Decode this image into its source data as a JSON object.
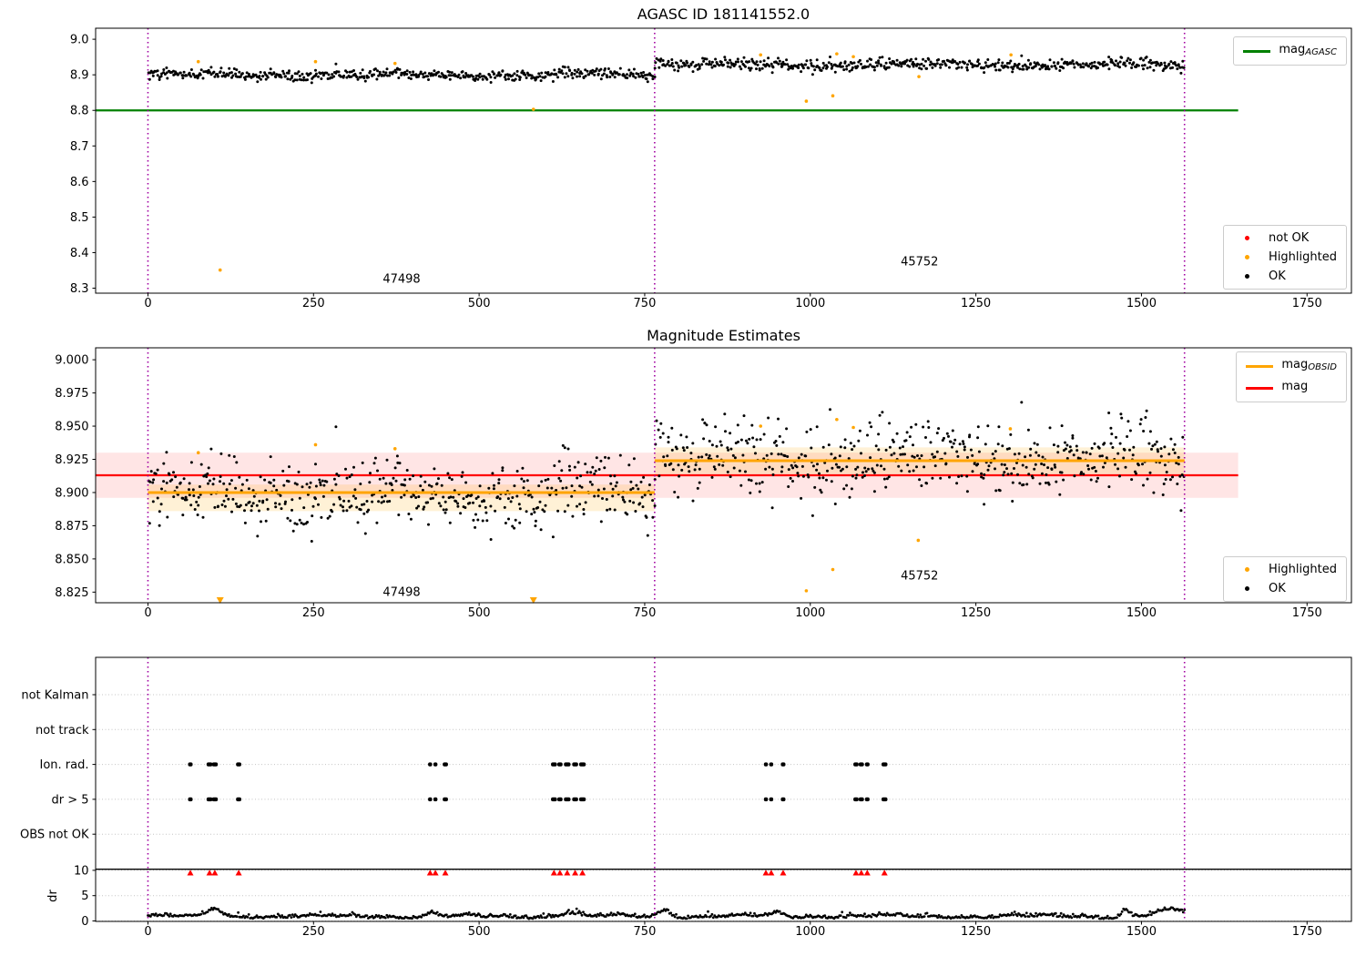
{
  "colors": {
    "green": "#008000",
    "red": "#ff0000",
    "orange": "#ffa500",
    "black": "#000000",
    "boundary": "#a000a0",
    "band_red": "rgba(255,0,0,0.10)",
    "band_orange": "rgba(255,165,0,0.16)",
    "grid": "#c4c4c4"
  },
  "chart_data": [
    {
      "type": "scatter",
      "title": "AGASC ID 181141552.0",
      "xlim": [
        -79,
        1817
      ],
      "ylim": [
        8.286,
        9.031
      ],
      "xticks": [
        0,
        250,
        500,
        750,
        1000,
        1250,
        1500,
        1750
      ],
      "yticks": [
        8.3,
        8.4,
        8.5,
        8.6,
        8.7,
        8.8,
        8.9,
        9.0
      ],
      "mag_agasc": 8.8,
      "hline_span": [
        -79,
        1646
      ],
      "obsid_boundaries": [
        0,
        765,
        1565
      ],
      "segments": [
        {
          "obsid": "47498",
          "x0": 0,
          "x1": 765,
          "mean": 8.9,
          "sd": 0.0075,
          "n": 520
        },
        {
          "obsid": "45752",
          "x0": 765,
          "x1": 1565,
          "mean": 8.928,
          "sd": 0.0085,
          "n": 540
        }
      ],
      "highlighted": [
        [
          76,
          8.937
        ],
        [
          109,
          8.351
        ],
        [
          253,
          8.937
        ],
        [
          373,
          8.932
        ],
        [
          582,
          8.803
        ],
        [
          925,
          8.956
        ],
        [
          994,
          8.826
        ],
        [
          1034,
          8.841
        ],
        [
          1040,
          8.959
        ],
        [
          1065,
          8.951
        ],
        [
          1164,
          8.895
        ],
        [
          1303,
          8.956
        ]
      ],
      "annotations": [
        {
          "text": "47498",
          "x": 383,
          "y": 8.3245
        },
        {
          "text": "45752",
          "x": 1165,
          "y": 8.373
        }
      ],
      "legend_line": {
        "label": "mag",
        "sub": "AGASC"
      },
      "legend_markers": [
        {
          "label": "not OK"
        },
        {
          "label": "Highlighted"
        },
        {
          "label": "OK"
        }
      ]
    },
    {
      "type": "scatter",
      "title": "Magnitude Estimates",
      "xlim": [
        -79,
        1817
      ],
      "ylim": [
        8.817,
        9.009
      ],
      "xticks": [
        0,
        250,
        500,
        750,
        1000,
        1250,
        1500,
        1750
      ],
      "yticks": [
        8.825,
        8.85,
        8.875,
        8.9,
        8.925,
        8.95,
        8.975,
        9.0
      ],
      "mag": 8.913,
      "mag_band": [
        8.896,
        8.93
      ],
      "line_span": [
        -79,
        1646
      ],
      "obsid_boundaries": [
        0,
        765,
        1565
      ],
      "segments": [
        {
          "obsid": "47498",
          "x0": 0,
          "x1": 765,
          "mag_obsid": 8.9,
          "band": [
            8.886,
            8.906
          ],
          "mean": 8.899,
          "sd": 0.0125,
          "n": 520
        },
        {
          "obsid": "45752",
          "x0": 765,
          "x1": 1565,
          "mag_obsid": 8.924,
          "band": [
            8.914,
            8.934
          ],
          "mean": 8.925,
          "sd": 0.014,
          "n": 540
        }
      ],
      "highlighted": [
        [
          76,
          8.93
        ],
        [
          253,
          8.936
        ],
        [
          373,
          8.933
        ],
        [
          925,
          8.95
        ],
        [
          994,
          8.826
        ],
        [
          1034,
          8.842
        ],
        [
          1040,
          8.955
        ],
        [
          1065,
          8.949
        ],
        [
          1163,
          8.864
        ],
        [
          1302,
          8.948
        ]
      ],
      "clipped_low_x": [
        109,
        582
      ],
      "annotations": [
        {
          "text": "47498",
          "x": 383,
          "y": 8.8243
        },
        {
          "text": "45752",
          "x": 1165,
          "y": 8.8372
        }
      ],
      "legend_lines": [
        {
          "label": "mag",
          "sub": "OBSID",
          "color": "orange"
        },
        {
          "label": "mag",
          "sub": "",
          "color": "red"
        }
      ],
      "legend_markers": [
        {
          "label": "Highlighted"
        },
        {
          "label": "OK"
        }
      ]
    },
    {
      "type": "flags-timeline",
      "rows": [
        "not Kalman",
        "not track",
        "Ion. rad.",
        "dr > 5",
        "OBS not OK"
      ],
      "rows_with_events": [
        "Ion. rad.",
        "dr > 5"
      ],
      "xlim": [
        -79,
        1817
      ],
      "xticks": [
        0,
        250,
        500,
        750,
        1000,
        1250,
        1500,
        1750
      ],
      "obsid_boundaries": [
        0,
        765,
        1565
      ],
      "events": [
        {
          "x": 64,
          "w": 7
        },
        {
          "x": 93,
          "w": 9
        },
        {
          "x": 101,
          "w": 9
        },
        {
          "x": 137,
          "w": 8
        },
        {
          "x": 426,
          "w": 6
        },
        {
          "x": 434,
          "w": 6
        },
        {
          "x": 449,
          "w": 8
        },
        {
          "x": 613,
          "w": 9
        },
        {
          "x": 622,
          "w": 8
        },
        {
          "x": 633,
          "w": 10
        },
        {
          "x": 645,
          "w": 9
        },
        {
          "x": 656,
          "w": 10
        },
        {
          "x": 933,
          "w": 6
        },
        {
          "x": 941,
          "w": 5
        },
        {
          "x": 959,
          "w": 7
        },
        {
          "x": 1069,
          "w": 8
        },
        {
          "x": 1077,
          "w": 8
        },
        {
          "x": 1086,
          "w": 7
        },
        {
          "x": 1112,
          "w": 9
        }
      ],
      "dr_axis": {
        "ylabel": "dr",
        "ticks": [
          0,
          5,
          10
        ],
        "clip_value": 10
      },
      "dr_series": {
        "x0": 0,
        "x1": 1565,
        "n": 782,
        "base": 0.5,
        "noise": 0.33,
        "humps": [
          [
            100,
            1.5,
            14
          ],
          [
            430,
            0.7,
            10
          ],
          [
            636,
            0.8,
            16
          ],
          [
            780,
            1.2,
            14
          ],
          [
            950,
            0.7,
            12
          ],
          [
            1476,
            1.4,
            8
          ],
          [
            1545,
            1.2,
            30
          ]
        ]
      }
    }
  ]
}
